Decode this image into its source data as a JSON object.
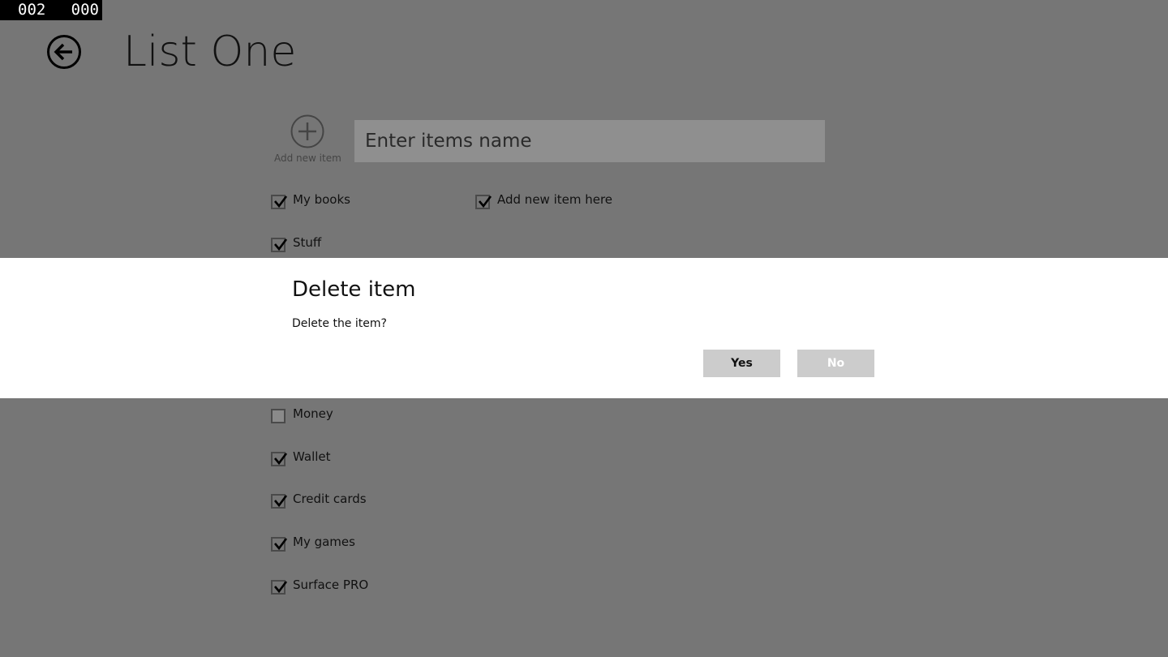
{
  "overlay_counter": {
    "left": "002",
    "right": "000"
  },
  "header": {
    "title": "List One",
    "back_icon": "back-arrow-circle-icon"
  },
  "add_item": {
    "icon": "plus-circle-icon",
    "label": "Add new item",
    "input_placeholder": "Enter items name",
    "input_value": ""
  },
  "items": [
    {
      "label": "My books",
      "checked": true
    },
    {
      "label": "Add new item here",
      "checked": true
    },
    {
      "label": "Stuff",
      "checked": true
    },
    {
      "label": "Money",
      "checked": false
    },
    {
      "label": "Wallet",
      "checked": true
    },
    {
      "label": "Credit cards",
      "checked": true
    },
    {
      "label": "My games",
      "checked": true
    },
    {
      "label": "Surface PRO",
      "checked": true
    }
  ],
  "dialog": {
    "title": "Delete item",
    "message": "Delete the item?",
    "yes_label": "Yes",
    "no_label": "No"
  },
  "colors": {
    "background_dim": "#767676",
    "dialog_background": "#ffffff",
    "input_background": "#8f8f8f",
    "button_background": "#cccccc"
  }
}
